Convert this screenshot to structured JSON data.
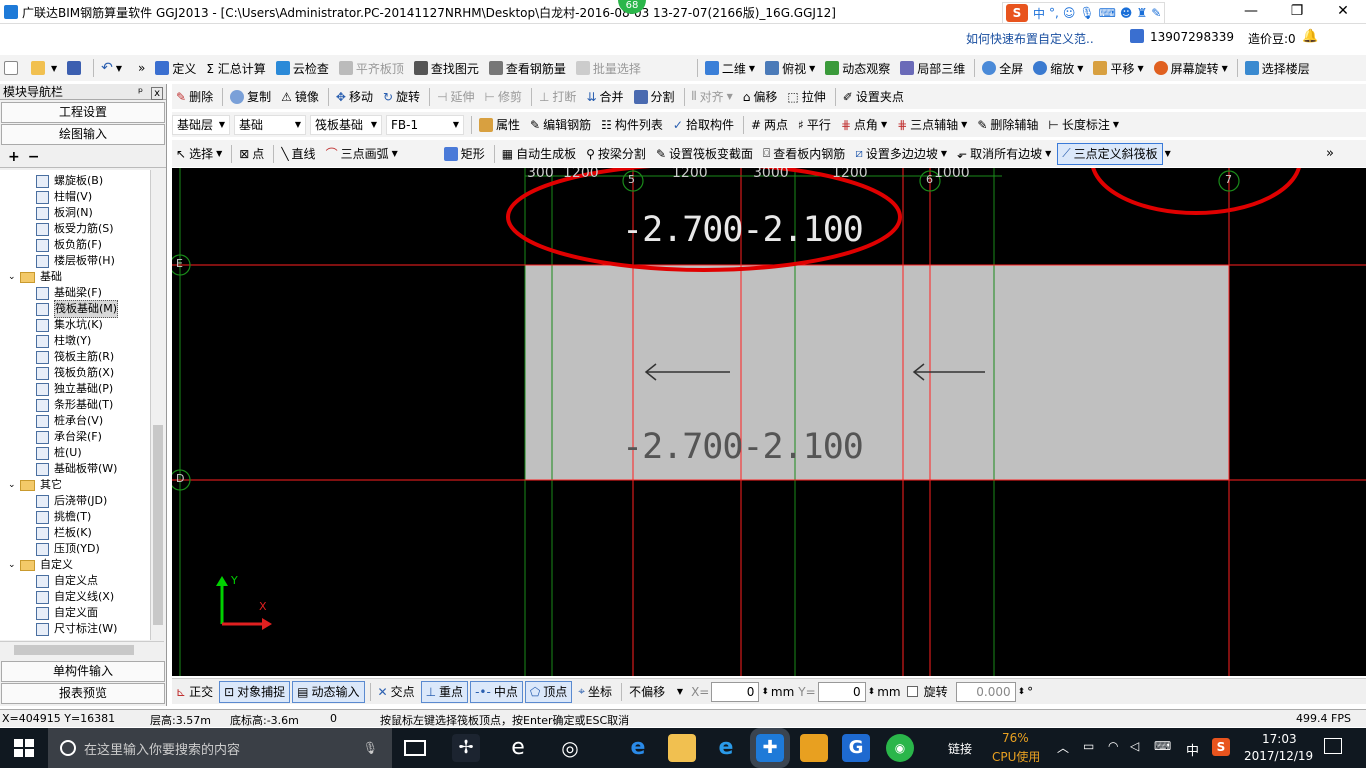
{
  "window": {
    "title": "广联达BIM钢筋算量软件 GGJ2013 - [C:\\Users\\Administrator.PC-20141127NRHM\\Desktop\\白龙村-2016-08-03 13-27-07(2166版)_16G.GGJ12]",
    "badge": "68",
    "minimize": "—",
    "maximize": "❐",
    "close": "✕"
  },
  "ime": {
    "label": "中",
    "punct": "°,"
  },
  "account": {
    "help_link": "如何快速布置自定义范..",
    "phone": "13907298339",
    "beans": "造价豆:0"
  },
  "toolbar1": {
    "items": [
      "定义",
      "Σ 汇总计算",
      "云检查",
      "平齐板顶",
      "查找图元",
      "查看钢筋量",
      "批量选择"
    ],
    "view_items": [
      "二维",
      "俯视",
      "动态观察",
      "局部三维",
      "全屏",
      "缩放",
      "平移",
      "屏幕旋转",
      "选择楼层"
    ]
  },
  "toolbar2": {
    "items": [
      "删除",
      "复制",
      "镜像",
      "移动",
      "旋转",
      "延伸",
      "修剪",
      "打断",
      "合并",
      "分割",
      "对齐",
      "偏移",
      "拉伸",
      "设置夹点"
    ]
  },
  "toolbar3": {
    "combo1": "基础层",
    "combo2": "基础",
    "combo3": "筏板基础",
    "combo4": "FB-1",
    "items": [
      "属性",
      "编辑钢筋",
      "构件列表",
      "拾取构件",
      "两点",
      "平行",
      "点角",
      "三点辅轴",
      "删除辅轴",
      "长度标注"
    ]
  },
  "toolbar4": {
    "items": [
      "选择",
      "点",
      "直线",
      "三点画弧",
      "矩形",
      "自动生成板",
      "按梁分割",
      "设置筏板变截面",
      "查看板内钢筋",
      "设置多边边坡",
      "取消所有边坡",
      "三点定义斜筏板"
    ]
  },
  "panel": {
    "title": "模块导航栏",
    "pin": "ᵖ",
    "close": "x",
    "btn_project": "工程设置",
    "btn_draw": "绘图输入",
    "add": "+",
    "remove": "−",
    "btn_single": "单构件输入",
    "btn_report": "报表预览"
  },
  "tree": [
    {
      "label": "螺旋板(B)",
      "type": "item",
      "level": 2
    },
    {
      "label": "柱帽(V)",
      "type": "item",
      "level": 2
    },
    {
      "label": "板洞(N)",
      "type": "item",
      "level": 2
    },
    {
      "label": "板受力筋(S)",
      "type": "item",
      "level": 2
    },
    {
      "label": "板负筋(F)",
      "type": "item",
      "level": 2
    },
    {
      "label": "楼层板带(H)",
      "type": "item",
      "level": 2
    },
    {
      "label": "基础",
      "type": "folder",
      "level": 1
    },
    {
      "label": "基础梁(F)",
      "type": "item",
      "level": 2
    },
    {
      "label": "筏板基础(M)",
      "type": "item",
      "level": 2,
      "selected": true
    },
    {
      "label": "集水坑(K)",
      "type": "item",
      "level": 2
    },
    {
      "label": "柱墩(Y)",
      "type": "item",
      "level": 2
    },
    {
      "label": "筏板主筋(R)",
      "type": "item",
      "level": 2
    },
    {
      "label": "筏板负筋(X)",
      "type": "item",
      "level": 2
    },
    {
      "label": "独立基础(P)",
      "type": "item",
      "level": 2
    },
    {
      "label": "条形基础(T)",
      "type": "item",
      "level": 2
    },
    {
      "label": "桩承台(V)",
      "type": "item",
      "level": 2
    },
    {
      "label": "承台梁(F)",
      "type": "item",
      "level": 2
    },
    {
      "label": "桩(U)",
      "type": "item",
      "level": 2
    },
    {
      "label": "基础板带(W)",
      "type": "item",
      "level": 2
    },
    {
      "label": "其它",
      "type": "folder",
      "level": 1
    },
    {
      "label": "后浇带(JD)",
      "type": "item",
      "level": 2
    },
    {
      "label": "挑檐(T)",
      "type": "item",
      "level": 2
    },
    {
      "label": "栏板(K)",
      "type": "item",
      "level": 2
    },
    {
      "label": "压顶(YD)",
      "type": "item",
      "level": 2
    },
    {
      "label": "自定义",
      "type": "folder",
      "level": 1
    },
    {
      "label": "自定义点",
      "type": "item",
      "level": 2
    },
    {
      "label": "自定义线(X)",
      "type": "item",
      "level": 2
    },
    {
      "label": "自定义面",
      "type": "item",
      "level": 2
    },
    {
      "label": "尺寸标注(W)",
      "type": "item",
      "level": 2
    }
  ],
  "canvas": {
    "dims": [
      "300",
      "1200",
      "1200",
      "3000",
      "1200",
      "1000"
    ],
    "axis_numbers": [
      "5",
      "6",
      "7"
    ],
    "axis_letters": [
      "E",
      "D"
    ],
    "elev_top": "-2.700-2.100",
    "elev_mid": "-2.700-2.100",
    "ucs_y": "Y",
    "ucs_x": "X"
  },
  "bottom": {
    "items": [
      "正交",
      "对象捕捉",
      "动态输入",
      "交点",
      "重点",
      "中点",
      "顶点",
      "坐标"
    ],
    "offset_mode": "不偏移",
    "x_label": "X=",
    "x_value": "0",
    "mm1": "mm",
    "y_label": "Y=",
    "y_value": "0",
    "mm2": "mm",
    "rotate_label": "旋转",
    "rotate_value": "0.000",
    "deg": "°"
  },
  "status": {
    "coords": "X=404915 Y=16381",
    "floor_height": "层高:3.57m",
    "bottom_height": "底标高:-3.6m",
    "zero": "0",
    "hint": "按鼠标左键选择筏板顶点，按Enter确定或ESC取消",
    "fps": "499.4 FPS"
  },
  "taskbar": {
    "search_placeholder": "在这里输入你要搜索的内容",
    "link": "链接",
    "cpu_pct": "76%",
    "cpu_label": "CPU使用",
    "ime": "中",
    "time": "17:03",
    "date": "2017/12/19"
  },
  "colors": {
    "accent_red": "#e00000",
    "grid_red": "#ff2020",
    "grid_green": "#1a8a1a",
    "slab_gray": "#c0c0c0"
  }
}
